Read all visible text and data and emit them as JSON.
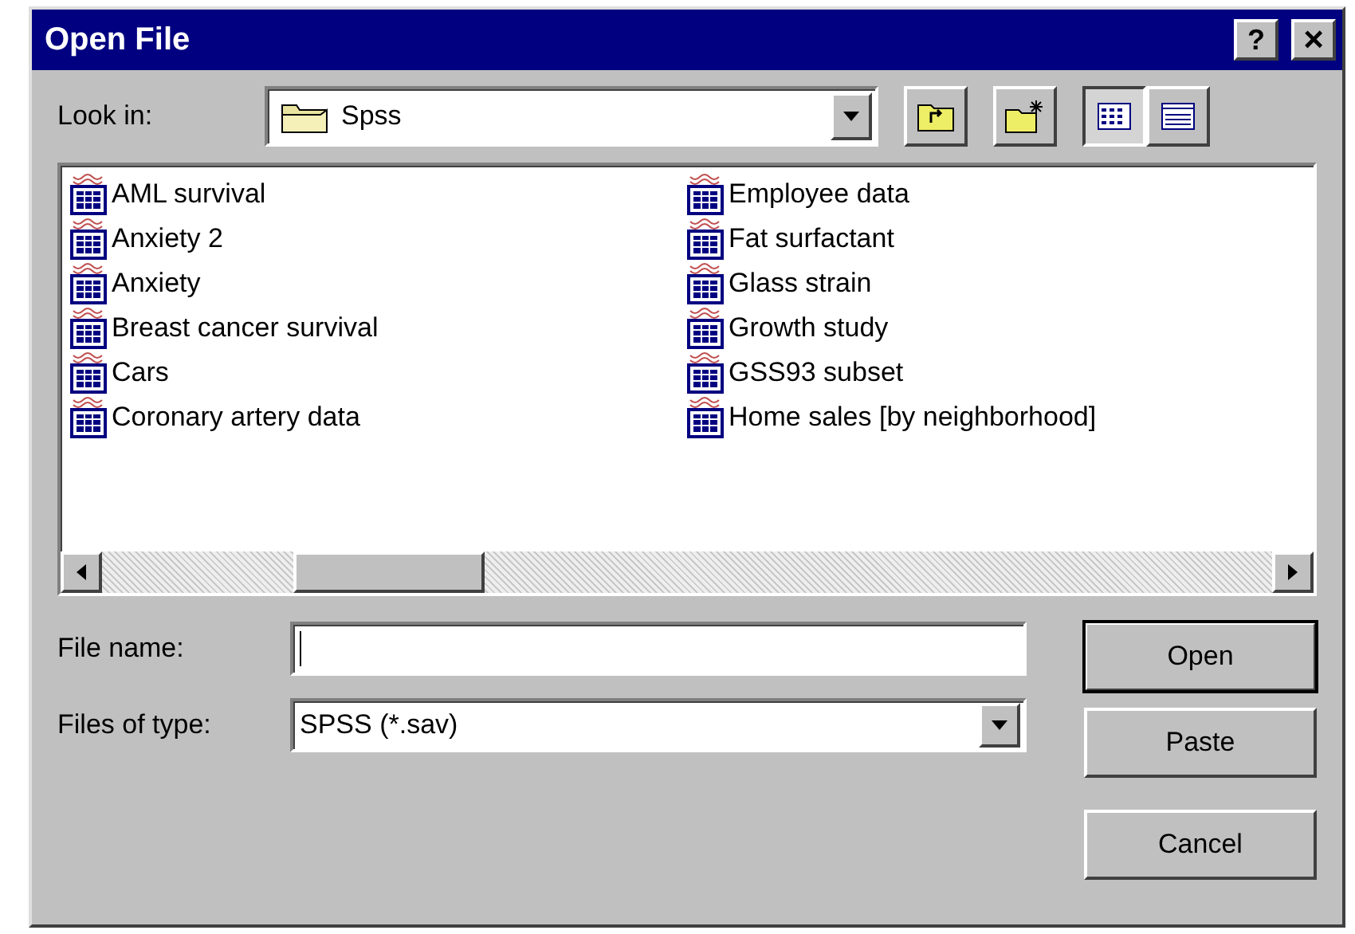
{
  "window": {
    "title": "Open File",
    "controls": [
      {
        "kind": "help",
        "label": "?"
      },
      {
        "kind": "close",
        "label": "×"
      }
    ]
  },
  "look_in": {
    "label": "Look in:",
    "value": "Spss"
  },
  "view_buttons": [
    {
      "kind": "list",
      "selected": true
    },
    {
      "kind": "details",
      "selected": false
    }
  ],
  "files": [
    {
      "name": "AML survival",
      "selected": false
    },
    {
      "name": "Anxiety 2",
      "selected": false
    },
    {
      "name": "Anxiety",
      "selected": false
    },
    {
      "name": "Breast cancer survival",
      "selected": false
    },
    {
      "name": "Cars",
      "selected": false
    },
    {
      "name": "Coronary artery data",
      "selected": false
    },
    {
      "name": "Employee data",
      "selected": false
    },
    {
      "name": "Fat surfactant",
      "selected": false
    },
    {
      "name": "Glass strain",
      "selected": false
    },
    {
      "name": "Growth study",
      "selected": false
    },
    {
      "name": "GSS93 subset",
      "selected": false
    },
    {
      "name": "Home sales [by neighborhood]",
      "selected": false
    }
  ],
  "file_name": {
    "label": "File name:"
  },
  "files_of_type": {
    "label": "Files of type:",
    "value": "SPSS (*.sav)"
  },
  "buttons": [
    {
      "label": "Open",
      "default": true
    },
    {
      "label": "Paste",
      "default": false
    },
    {
      "label": "Cancel",
      "default": false
    }
  ]
}
